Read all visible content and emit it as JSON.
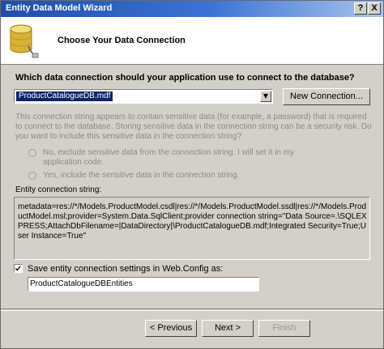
{
  "window": {
    "title": "Entity Data Model Wizard",
    "help_button": "?",
    "close_button": "X"
  },
  "header": {
    "title": "Choose Your Data Connection"
  },
  "connection": {
    "question": "Which data connection should your application use to connect to the database?",
    "selected": "ProductCatalogueDB.mdf",
    "new_connection_label": "New Connection...",
    "sensitive_warning": "This connection string appears to contain sensitive data (for example, a password) that is required to connect to the database. Storing sensitive data in the connection string can be a security risk. Do you want to include this sensitive data in the connection string?",
    "option_no": "No, exclude sensitive data from the connection string. I will set it in my application code.",
    "option_yes": "Yes, include the sensitive data in the connection string.",
    "entity_string_label": "Entity connection string:",
    "entity_string": "metadata=res://*/Models.ProductModel.csdl|res://*/Models.ProductModel.ssdl|res://*/Models.ProductModel.msl;provider=System.Data.SqlClient;provider connection string=\"Data Source=.\\SQLEXPRESS;AttachDbFilename=|DataDirectory|\\ProductCatalogueDB.mdf;Integrated Security=True;User Instance=True\""
  },
  "settings": {
    "save_checked": true,
    "save_label": "Save entity connection settings in Web.Config as:",
    "name_value": "ProductCatalogueDBEntities"
  },
  "footer": {
    "previous": "< Previous",
    "next": "Next >",
    "finish": "Finish"
  }
}
